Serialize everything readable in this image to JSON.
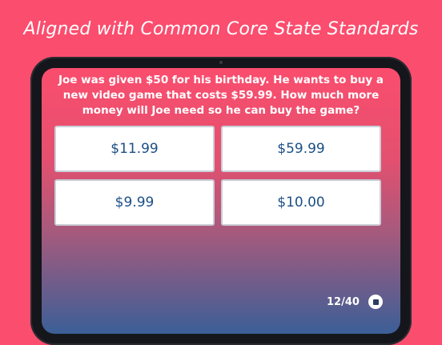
{
  "banner": {
    "text": "Aligned with Common Core State Standards"
  },
  "quiz": {
    "question": "Joe was given $50 for his birthday. He wants to buy a new video game that costs $59.99. How much more money will Joe need so he can buy the game?",
    "answers": [
      "$11.99",
      "$59.99",
      "$9.99",
      "$10.00"
    ],
    "progress": "12/40",
    "stop_icon": "stop-icon"
  },
  "colors": {
    "background": "#fb4d6e",
    "answer_text": "#1c4f86",
    "gradient_bottom": "#3b5f97"
  }
}
